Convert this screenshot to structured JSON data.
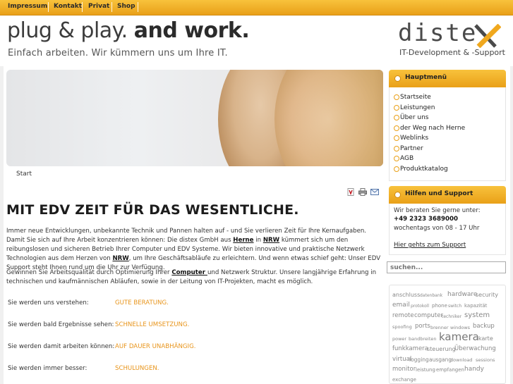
{
  "topnav": [
    "Impressum",
    "Kontakt",
    "Privat",
    "Shop"
  ],
  "header": {
    "slogan_light": "plug & play.",
    "slogan_bold": "and work.",
    "tagline": "Einfach arbeiten. Wir kümmern uns um Ihre IT.",
    "logo": "diste",
    "logo_sub": "IT-Development & -Support"
  },
  "breadcrumb": "Start",
  "icons": [
    "pdf-icon",
    "print-icon",
    "email-icon"
  ],
  "main": {
    "title": "MIT EDV ZEIT FÜR DAS WESENTLICHE.",
    "p1_a": "Immer neue Entwicklungen, unbekannte Technik und Pannen halten auf - und Sie verlieren Zeit für Ihre Kernaufgaben. Damit Sie sich auf Ihre Arbeit konzentrieren können: Die distex GmbH aus ",
    "p1_link1": "Herne",
    "p1_b": " in ",
    "p1_link2": "NRW",
    "p1_c": " kümmert sich um den reibungslosen und sicheren Betrieb Ihrer Computer und EDV Systeme. Wir bieten innovative und praktische Netzwerk Technologien aus dem Herzen von ",
    "p1_link3": "NRW",
    "p1_d": ", um Ihre Geschäftsabläufe zu erleichtern. Und wenn etwas schief geht: Unser EDV Support steht Ihnen rund um die Uhr zur Verfügung.",
    "p2_a": "Gewinnen Sie Arbeitsqualität durch Optimierung Ihrer ",
    "p2_link": "Computer ",
    "p2_b": "und Netzwerk Struktur. Unsere langjährige Erfahrung in technischen und kaufmännischen Abläufen, sowie in der Leitung von IT-Projekten, macht es möglich.",
    "rows": [
      {
        "label": "Sie werden uns verstehen:",
        "value": "GUTE BERATUNG."
      },
      {
        "label": "Sie werden bald Ergebnisse sehen:",
        "value": "SCHNELLE UMSETZUNG."
      },
      {
        "label": "Sie werden damit arbeiten können:",
        "value": "AUF DAUER UNABHÄNGIG."
      },
      {
        "label": "Sie werden immer besser:",
        "value": "SCHULUNGEN."
      }
    ]
  },
  "menu": {
    "heading": "Hauptmenü",
    "items": [
      "Startseite",
      "Leistungen",
      "Über uns",
      "der Weg nach Herne",
      "Weblinks",
      "Partner",
      "AGB",
      "Produktkatalog"
    ]
  },
  "support": {
    "heading": "Hilfen und Support",
    "line1": "Wir beraten Sie gerne unter:",
    "phone": "+49 2323 3689000",
    "hours": "wochentags von 08 - 17 Uhr",
    "link": "Hier gehts zum Support"
  },
  "search": {
    "placeholder": "suchen..."
  },
  "tags": [
    "anschluss",
    "datenbank",
    "hardware",
    "security",
    "email",
    "protokoll",
    "phone",
    "switch",
    "kapazität",
    "remote",
    "computer",
    "techniker",
    "system",
    "spoofing",
    "ports",
    "brenner",
    "windows",
    "backup",
    "power",
    "bandbreiten",
    "kamera",
    "karte",
    "funkkamera",
    "steuerung",
    "Überwachung",
    "virtual",
    "logging",
    "ausgang",
    "download",
    "sessions",
    "monitor",
    "leistung",
    "empfangen",
    "handy",
    "exchange"
  ],
  "colors": {
    "accent": "#f0b02a",
    "orange_text": "#e8941a",
    "dark": "#222222"
  }
}
